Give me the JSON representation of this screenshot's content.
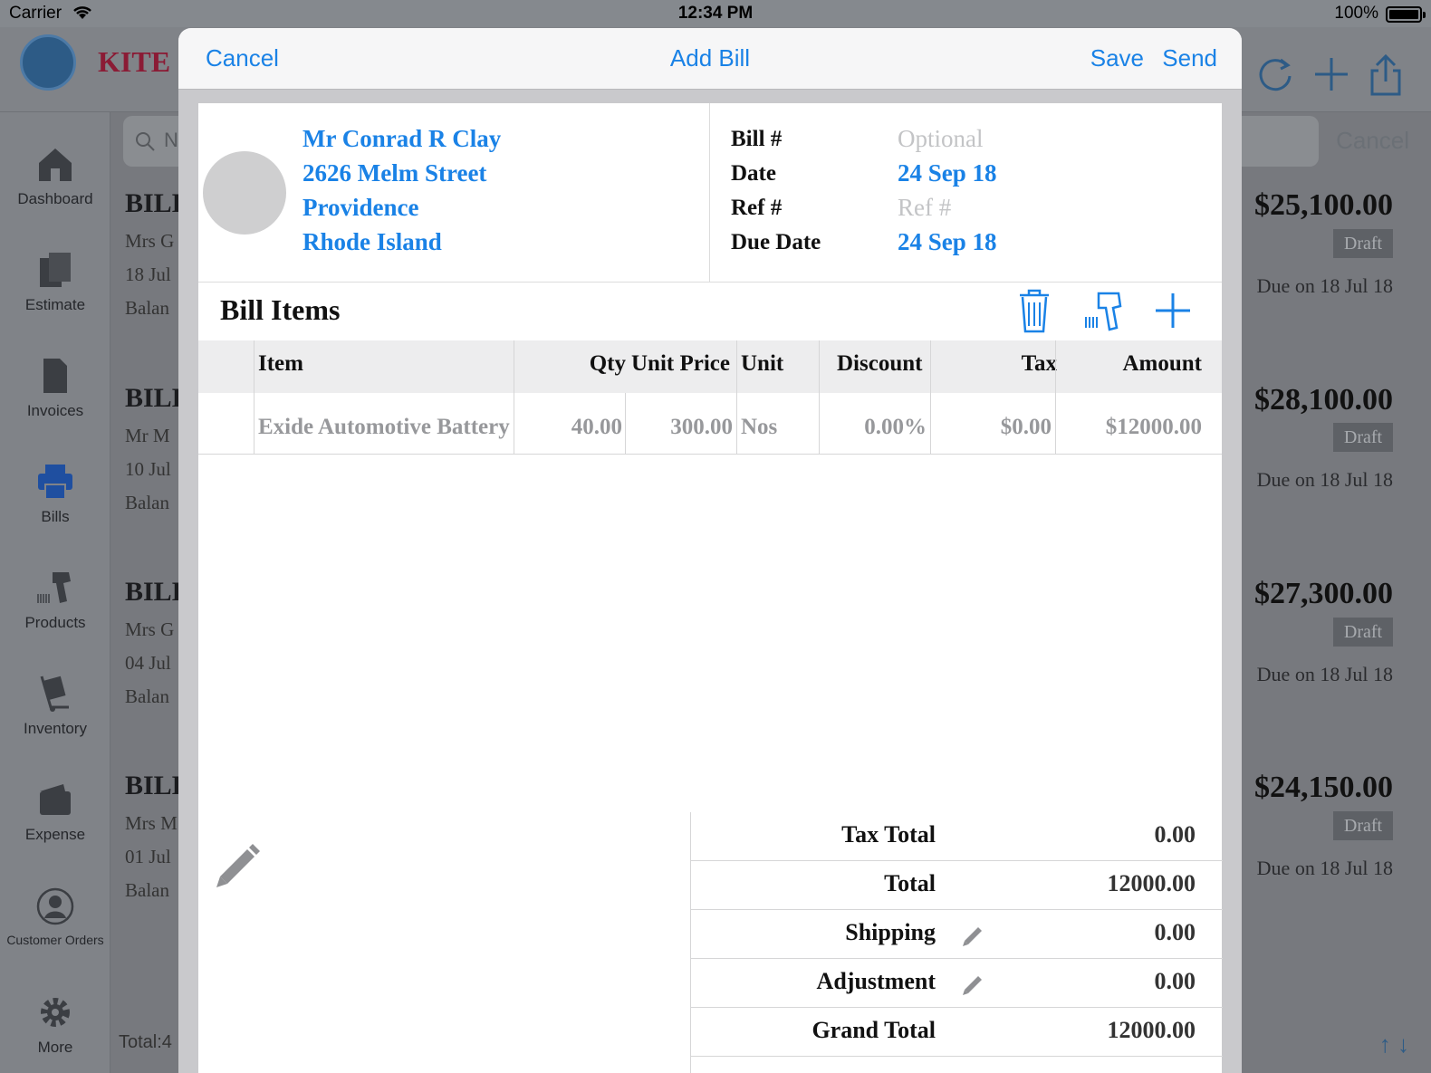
{
  "status": {
    "carrier": "Carrier",
    "time": "12:34 PM",
    "battery": "100%"
  },
  "app": {
    "brand": "KITE I",
    "search_placeholder": "N",
    "search_cancel": "Cancel",
    "footer_total": "Total:4"
  },
  "sidebar": {
    "items": [
      {
        "label": "Dashboard",
        "icon": "home-icon"
      },
      {
        "label": "Estimate",
        "icon": "documents-icon"
      },
      {
        "label": "Invoices",
        "icon": "document-icon"
      },
      {
        "label": "Bills",
        "icon": "printer-icon"
      },
      {
        "label": "Products",
        "icon": "barcode-scanner-icon"
      },
      {
        "label": "Inventory",
        "icon": "hand-truck-icon"
      },
      {
        "label": "Expense",
        "icon": "wallet-icon"
      },
      {
        "label": "Customer Orders",
        "icon": "person-icon"
      },
      {
        "label": "More",
        "icon": "gear-icon"
      }
    ]
  },
  "bg_list": [
    {
      "title": "BILL",
      "name": "Mrs G",
      "date": "18 Jul",
      "balance": "Balan",
      "amount": "$25,100.00",
      "status": "Draft",
      "due": "Due on 18 Jul 18"
    },
    {
      "title": "BILL",
      "name": "Mr M",
      "date": "10 Jul",
      "balance": "Balan",
      "amount": "$28,100.00",
      "status": "Draft",
      "due": "Due on 18 Jul 18"
    },
    {
      "title": "BILL",
      "name": "Mrs G",
      "date": "04 Jul",
      "balance": "Balan",
      "amount": "$27,300.00",
      "status": "Draft",
      "due": "Due on 18 Jul 18"
    },
    {
      "title": "BILL",
      "name": "Mrs M",
      "date": "01 Jul",
      "balance": "Balan",
      "amount": "$24,150.00",
      "status": "Draft",
      "due": "Due on 18 Jul 18"
    }
  ],
  "modal": {
    "cancel": "Cancel",
    "title": "Add Bill",
    "save": "Save",
    "send": "Send",
    "vendor": {
      "name": "Mr Conrad R  Clay",
      "street": "2626  Melm Street",
      "city": "Providence",
      "state": "Rhode Island"
    },
    "meta": {
      "bill_label": "Bill #",
      "bill_placeholder": "Optional",
      "date_label": "Date",
      "date_value": "24 Sep 18",
      "ref_label": "Ref #",
      "ref_placeholder": "Ref #",
      "due_label": "Due Date",
      "due_value": "24 Sep 18"
    },
    "items_title": "Bill Items",
    "columns": {
      "item": "Item",
      "qty": "Qty",
      "unit_price": "Unit Price",
      "unit": "Unit",
      "discount": "Discount",
      "tax": "Tax",
      "amount": "Amount"
    },
    "rows": [
      {
        "item": "Exide Automotive Battery",
        "qty": "40.00",
        "unit_price": "300.00",
        "unit": "Nos",
        "discount": "0.00%",
        "tax": "$0.00",
        "amount": "$12000.00"
      }
    ],
    "totals": {
      "tax_total_label": "Tax Total",
      "tax_total": "0.00",
      "total_label": "Total",
      "total": "12000.00",
      "shipping_label": "Shipping",
      "shipping": "0.00",
      "adjustment_label": "Adjustment",
      "adjustment": "0.00",
      "grand_total_label": "Grand Total",
      "grand_total": "12000.00"
    }
  },
  "colors": {
    "accent": "#1a82e6",
    "placeholder": "#c3c4c6",
    "brand": "#8b1b35"
  }
}
